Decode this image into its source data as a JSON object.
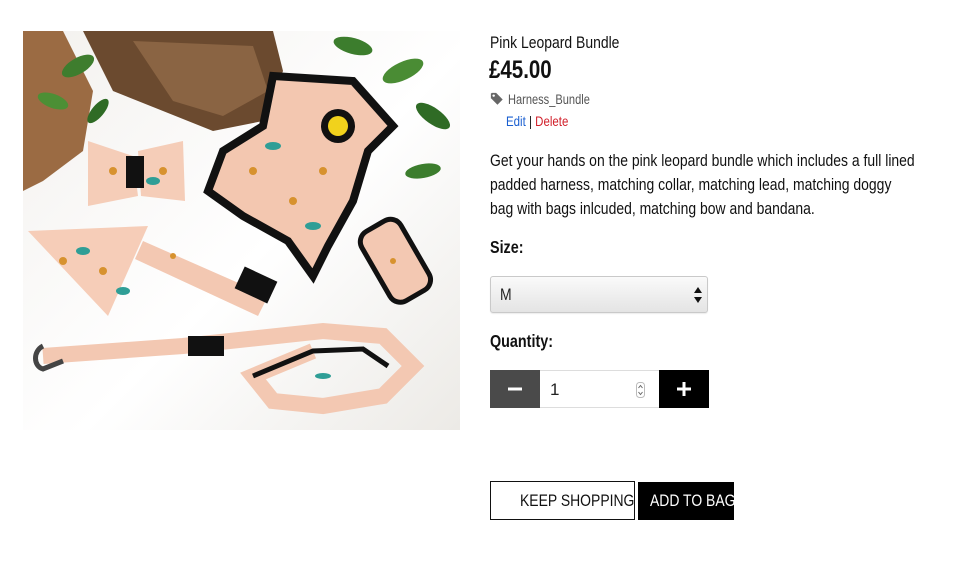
{
  "product": {
    "title": "Pink Leopard Bundle",
    "price": "£45.00",
    "tag": "Harness_Bundle",
    "description": "Get your hands on the pink leopard bundle which includes a full lined padded harness, matching collar, matching lead, matching doggy bag with bags inlcuded, matching bow and bandana."
  },
  "admin": {
    "edit_label": "Edit",
    "separator": "|",
    "delete_label": "Delete"
  },
  "size": {
    "label": "Size:",
    "selected": "M"
  },
  "quantity": {
    "label": "Quantity:",
    "value": "1"
  },
  "actions": {
    "keep_shopping_label": "KEEP SHOPPING",
    "add_to_bag_label": "ADD TO BAG"
  },
  "colors": {
    "edit_link": "#1a5fd0",
    "delete_link": "#d11f2a",
    "primary_button": "#000000",
    "minus_button": "#4a4a4a"
  },
  "icons": {
    "tag": "tag-icon",
    "keep_shopping": "chevron-left-icon",
    "minus": "minus-icon",
    "plus": "plus-icon",
    "select": "select-arrows-icon"
  }
}
